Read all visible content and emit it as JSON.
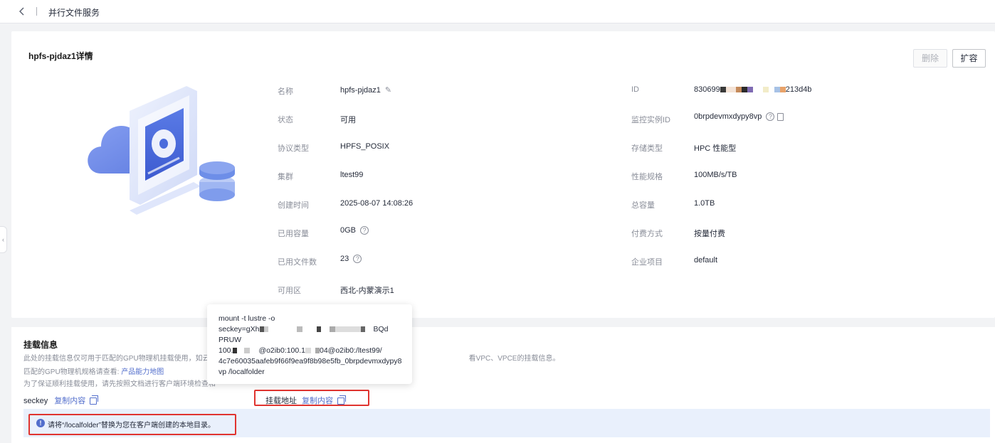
{
  "header": {
    "back_icon": "chevron-left-icon",
    "title": "并行文件服务"
  },
  "detail": {
    "title": "hpfs-pjdaz1详情",
    "buttons": {
      "delete": "删除",
      "expand": "扩容"
    },
    "left": [
      {
        "label": "名称",
        "value": "hpfs-pjdaz1"
      },
      {
        "label": "状态",
        "value": "可用"
      },
      {
        "label": "协议类型",
        "value": "HPFS_POSIX"
      },
      {
        "label": "集群",
        "value": "ltest99"
      },
      {
        "label": "创建时间",
        "value": "2025-08-07 14:08:26"
      },
      {
        "label": "已用容量",
        "value": "0GB"
      },
      {
        "label": "已用文件数",
        "value": "23"
      },
      {
        "label": "可用区",
        "value": "西北-内蒙演示1"
      }
    ],
    "right": [
      {
        "label": "ID",
        "value_prefix": "830699",
        "value_suffix": "213d4b"
      },
      {
        "label": "监控实例ID",
        "value": "0brpdevmxdypy8vp"
      },
      {
        "label": "存储类型",
        "value": "HPC 性能型"
      },
      {
        "label": "性能规格",
        "value": "100MB/s/TB"
      },
      {
        "label": "总容量",
        "value": "1.0TB"
      },
      {
        "label": "付费方式",
        "value": "按量付费"
      },
      {
        "label": "企业项目",
        "value": "default"
      }
    ]
  },
  "popover": {
    "lines": [
      "mount -t lustre -o",
      "seckey=gXh",
      "PRUW",
      "100.",
      "4c7e60035aafeb9f66f9ea9f8b98e5fb_0brpdevmxdypy8",
      "vp /localfolder"
    ],
    "line2_tail": "BQd",
    "line4_mid": "@o2ib0:100.1",
    "line4_tail": "04@o2ib0:/ltest99/"
  },
  "mount": {
    "title": "挂载信息",
    "desc1_start": "此处的挂载信息仅可用于匹配的GPU物理机挂载使用，如云主",
    "desc1_end": "看VPC、VPCE的挂载信息。",
    "desc2_text": "匹配的GPU物理机规格请查看: ",
    "desc2_link": "产品能力地图",
    "desc3_text": "为了保证顺利挂载使用，请先按照文档进行客户端环境检查和",
    "seckey_label": "seckey",
    "copy_label": "复制内容",
    "mount_addr_label": "挂载地址",
    "info": "请将“/localfolder”替换为您在客户端创建的本地目录。"
  }
}
